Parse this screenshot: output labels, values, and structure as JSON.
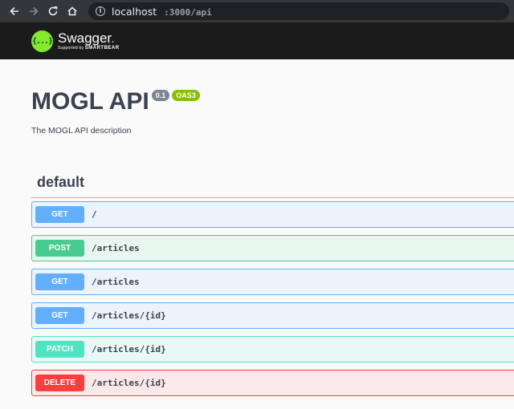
{
  "browser": {
    "url_host": "localhost",
    "url_path": ":3000/api"
  },
  "topbar": {
    "logo_glyph": "{...}",
    "logo_name": "Swagger",
    "logo_dot": ".",
    "logo_sub_prefix": "Supported by",
    "logo_sub_brand": "SMARTBEAR"
  },
  "info": {
    "title": "MOGL API",
    "version": "0.1",
    "oas": "OAS3",
    "description": "The MOGL API description"
  },
  "tag": {
    "name": "default"
  },
  "operations": [
    {
      "method": "GET",
      "path": "/"
    },
    {
      "method": "POST",
      "path": "/articles"
    },
    {
      "method": "GET",
      "path": "/articles"
    },
    {
      "method": "GET",
      "path": "/articles/{id}"
    },
    {
      "method": "PATCH",
      "path": "/articles/{id}"
    },
    {
      "method": "DELETE",
      "path": "/articles/{id}"
    }
  ],
  "colors": {
    "get": "#61affe",
    "post": "#49cc90",
    "patch": "#50e3c2",
    "delete": "#f93e3e",
    "swagger_green": "#85ea2d"
  },
  "icons": {
    "back": "arrow-left-icon",
    "forward": "arrow-right-icon",
    "reload": "reload-icon",
    "home": "home-icon",
    "site_info": "info-icon"
  }
}
